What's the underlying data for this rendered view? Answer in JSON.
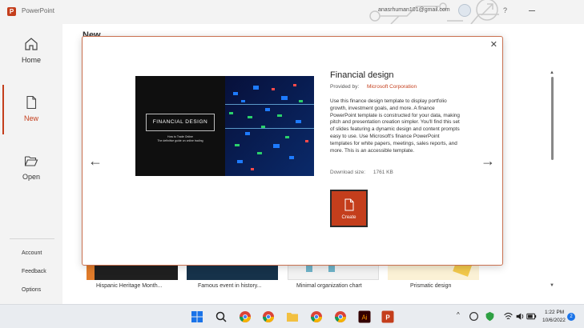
{
  "app": {
    "title": "PowerPoint",
    "account_email": "anasrhuman101@gmail.com",
    "help": "?",
    "logo_letter": "P"
  },
  "sidebar": {
    "items": [
      {
        "label": "Home",
        "icon": "home-icon"
      },
      {
        "label": "New",
        "icon": "new-file-icon",
        "active": true
      },
      {
        "label": "Open",
        "icon": "folder-open-icon"
      }
    ],
    "bottom": [
      "Account",
      "Feedback",
      "Options"
    ]
  },
  "main": {
    "heading": "New",
    "templates": [
      "Hispanic Heritage Month...",
      "Famous event in history...",
      "Minimal organization chart",
      "Prismatic design"
    ]
  },
  "modal": {
    "title": "Financial design",
    "provided_by_label": "Provided by:",
    "provider": "Microsoft Corporation",
    "description": "Use this finance design template to display portfolio growth, investment goals, and more. A finance PowerPoint template is constructed for your data, making pitch and presentation creation simpler. You'll find this set of slides featuring a dynamic design and content prompts easy to use. Use Microsoft's finance PowerPoint templates for white papers, meetings, sales reports, and more. This is an accessible template.",
    "download_label": "Download size:",
    "download_size": "1761 KB",
    "create_label": "Create",
    "close": "✕",
    "prev": "←",
    "next": "→",
    "preview": {
      "heading": "FINANCIAL DESIGN",
      "sub1": "How to Trade Online",
      "sub2": "The definitive guide on online trading"
    }
  },
  "taskbar": {
    "time": "1:22 PM",
    "date": "10/6/2022",
    "notifications": "2",
    "chevron": "^",
    "ai_label": "Ai"
  },
  "colors": {
    "accent": "#c43e1c",
    "taskbar": "#e9ecf0"
  }
}
